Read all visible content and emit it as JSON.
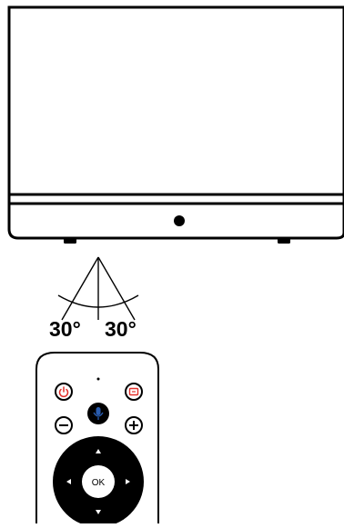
{
  "angles": {
    "left_label": "30°",
    "right_label": "30°"
  },
  "remote": {
    "ok_label": "OK",
    "power_icon": "power-icon",
    "input_icon": "input-source-icon",
    "mic_icon": "microphone-icon",
    "minus_icon": "minus-icon",
    "plus_icon": "plus-icon",
    "colors": {
      "power": "#e2312c",
      "input": "#e2312c",
      "mic": "#2a5db0",
      "dpad": "#000000"
    }
  }
}
